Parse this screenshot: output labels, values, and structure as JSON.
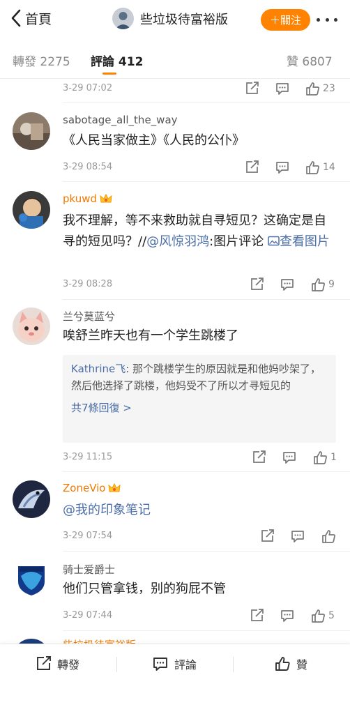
{
  "header": {
    "back_label": "首頁",
    "title": "些垃圾待富裕版",
    "follow_label": "＋關注"
  },
  "tabs": {
    "repost": "轉發 2275",
    "comment": "評論 412",
    "like": "贊 6807"
  },
  "comments": [
    {
      "time": "3-29 07:02",
      "likes": "23"
    },
    {
      "name": "sabotage_all_the_way",
      "text": "《人民当家做主》《人民的公仆》",
      "time": "3-29 08:54",
      "likes": "14"
    },
    {
      "name": "pkuwd",
      "text_prefix": "我不理解，等不来救助就自寻短见？这确定是自寻的短见吗？//",
      "mention": "@风惊羽鸿",
      "text_mid": ":图片评论 ",
      "image_link": "查看图片",
      "time": "3-29 08:28",
      "likes": "9"
    },
    {
      "name": "兰兮莫蓝兮",
      "text": "唉舒兰昨天也有一个学生跳楼了",
      "reply_author": "Kathrine飞",
      "reply_text": ": 那个跳楼学生的原因就是和他妈吵架了，然后他选择了跳楼，他妈受不了所以才寻短见的",
      "reply_more": "共7條回復 >",
      "time": "3-29 11:15",
      "likes": "1"
    },
    {
      "name": "ZoneVio",
      "mention": "@我的印象笔记",
      "time": "3-29 07:54",
      "likes": ""
    },
    {
      "name": "骑士爱爵士",
      "text": "他们只管拿钱，别的狗屁不管",
      "time": "3-29 07:44",
      "likes": "5"
    },
    {
      "name": "些垃圾待富裕版"
    }
  ],
  "bottom_bar": {
    "repost": "轉發",
    "comment": "評論",
    "like": "贊"
  },
  "colors": {
    "accent": "#ff8200",
    "link": "#4b6ea8",
    "vip_name": "#f07a00",
    "meta": "#999999"
  }
}
